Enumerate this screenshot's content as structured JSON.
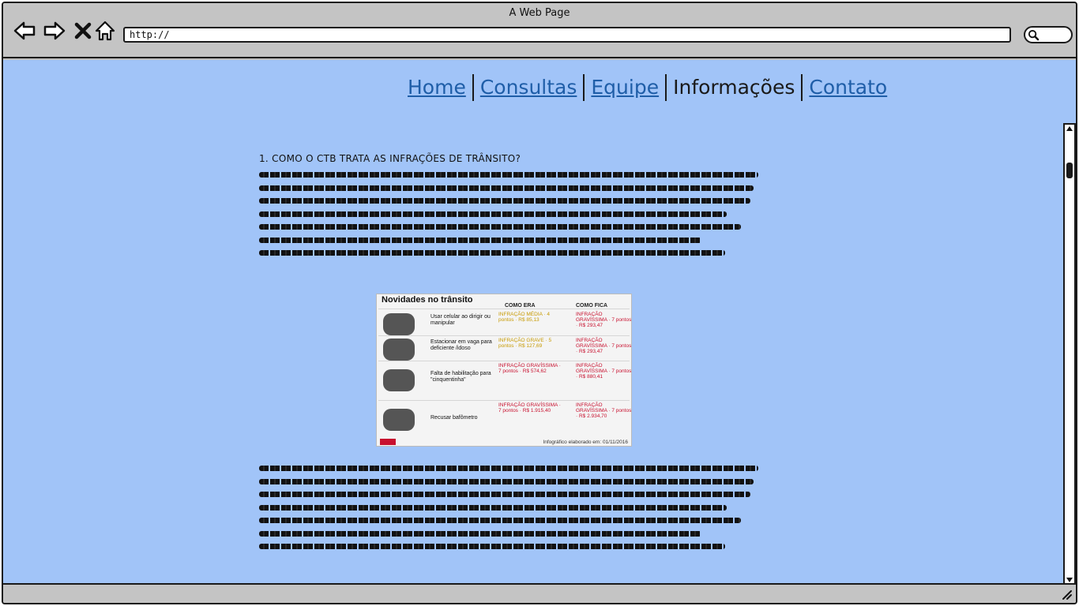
{
  "window": {
    "title": "A Web Page"
  },
  "browser": {
    "url": "http://"
  },
  "nav": {
    "items": [
      {
        "label": " Home"
      },
      {
        "label": "Consultas"
      },
      {
        "label": "Equipe"
      },
      {
        "label": "Informações"
      },
      {
        "label": "Contato "
      }
    ],
    "current": "Informações"
  },
  "article": {
    "heading": "1. COMO O CTB TRATA AS INFRAÇÕES DE TRÂNSITO?"
  },
  "infographic": {
    "title": "Novidades no trânsito",
    "col_before": "COMO ERA",
    "col_after": "COMO FICA",
    "rows": [
      {
        "label": "Usar celular ao dirigir ou manipular",
        "before": "INFRAÇÃO MÉDIA · 4 pontos · R$ 85,13",
        "after": "INFRAÇÃO GRAVÍSSIMA · 7 pontos · R$ 293,47"
      },
      {
        "label": "Estacionar em vaga para deficiente /idoso",
        "before": "INFRAÇÃO GRAVE · 5 pontos · R$ 127,69",
        "after": "INFRAÇÃO GRAVÍSSIMA · 7 pontos · R$ 293,47"
      },
      {
        "label": "Falta de habilitação para \"cinquentinha\"",
        "before": "INFRAÇÃO GRAVÍSSIMA · 7 pontos · R$ 574,62",
        "after": "INFRAÇÃO GRAVÍSSIMA · 7 pontos · R$ 880,41"
      },
      {
        "label": "Recusar bafômetro",
        "before": "INFRAÇÃO GRAVÍSSIMA · 7 pontos · R$ 1.915,40",
        "after": "INFRAÇÃO GRAVÍSSIMA · 7 pontos · R$ 2.934,70"
      }
    ],
    "footer": "Infográfico elaborado em: 01/11/2016"
  },
  "colors": {
    "page_bg": "#a1c4f8",
    "link": "#1f5ea8",
    "chrome": "#c4c4c4"
  },
  "icons": [
    "back-arrow-icon",
    "forward-arrow-icon",
    "stop-x-icon",
    "home-icon",
    "search-icon",
    "resize-grip-icon"
  ]
}
